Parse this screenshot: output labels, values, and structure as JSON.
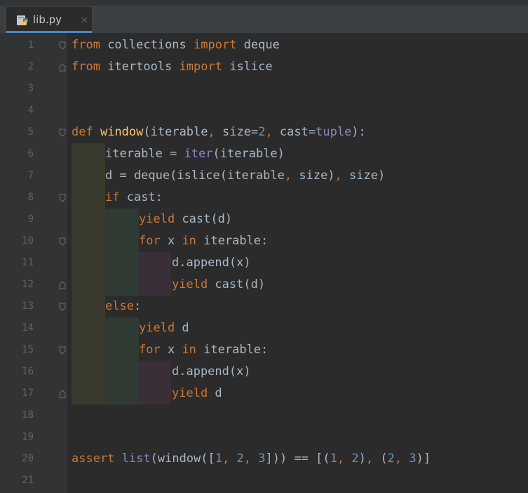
{
  "tab": {
    "filename": "lib.py",
    "close_glyph": "×",
    "icon": "python-file-icon"
  },
  "colors": {
    "background": "#2b2b2b",
    "gutter": "#313335",
    "keyword": "#cc7832",
    "function": "#ffc66d",
    "number": "#6897bb",
    "builtin": "#8888c6",
    "text": "#a9b7c6",
    "indent_level_1": "#3b3a2e",
    "indent_level_2": "#2f3a32",
    "indent_level_3": "#3a2e38"
  },
  "line_numbers": [
    "1",
    "2",
    "3",
    "4",
    "5",
    "6",
    "7",
    "8",
    "9",
    "10",
    "11",
    "12",
    "13",
    "14",
    "15",
    "16",
    "17",
    "18",
    "19",
    "20",
    "21"
  ],
  "code": {
    "l1": {
      "k1": "from",
      "t1": " collections ",
      "k2": "import",
      "t2": " deque"
    },
    "l2": {
      "k1": "from",
      "t1": " itertools ",
      "k2": "import",
      "t2": " islice"
    },
    "l5": {
      "k1": "def",
      "t0": " ",
      "f1": "window",
      "t1": "(iterable",
      "p1": ",",
      "t2": " size=",
      "n1": "2",
      "p2": ",",
      "t3": " cast=",
      "b1": "tuple",
      "t4": "):"
    },
    "l6": {
      "t1": "iterable = ",
      "b1": "iter",
      "t2": "(iterable)"
    },
    "l7": {
      "t1": "d = deque(islice(iterable",
      "p1": ",",
      "t2": " size)",
      "p2": ",",
      "t3": " size)"
    },
    "l8": {
      "k1": "if",
      "t1": " cast:"
    },
    "l9": {
      "k1": "yield",
      "t1": " cast(d)"
    },
    "l10": {
      "k1": "for",
      "t1": " x ",
      "k2": "in",
      "t2": " iterable:"
    },
    "l11": {
      "t1": "d.append(x)"
    },
    "l12": {
      "k1": "yield",
      "t1": " cast(d)"
    },
    "l13": {
      "k1": "else",
      "t1": ":"
    },
    "l14": {
      "k1": "yield",
      "t1": " d"
    },
    "l15": {
      "k1": "for",
      "t1": " x ",
      "k2": "in",
      "t2": " iterable:"
    },
    "l16": {
      "t1": "d.append(x)"
    },
    "l17": {
      "k1": "yield",
      "t1": " d"
    },
    "l20": {
      "k1": "assert",
      "t0": " ",
      "b1": "list",
      "t1": "(window([",
      "n1": "1",
      "p1": ",",
      "t2": " ",
      "n2": "2",
      "p2": ",",
      "t3": " ",
      "n3": "3",
      "t4": "])) == [(",
      "n4": "1",
      "p3": ",",
      "t5": " ",
      "n5": "2",
      "t6": ")",
      "p4": ",",
      "t7": " (",
      "n6": "2",
      "p5": ",",
      "t8": " ",
      "n7": "3",
      "t9": ")]"
    }
  }
}
